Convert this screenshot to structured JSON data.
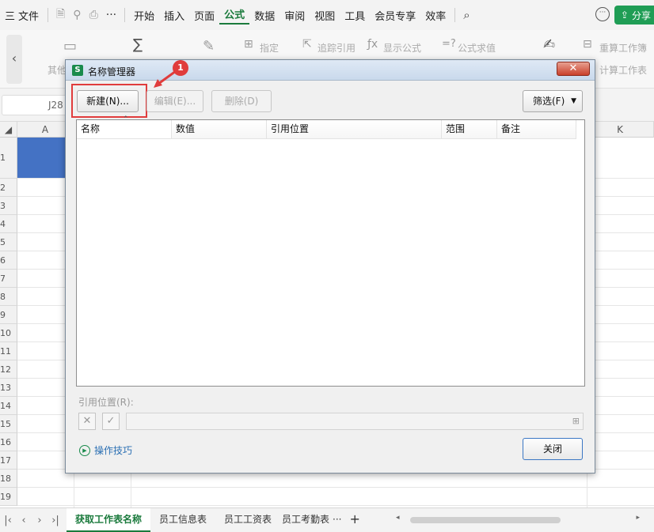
{
  "menubar": {
    "hamburger": "三",
    "file": "文件",
    "tabs": [
      "开始",
      "插入",
      "页面",
      "公式",
      "数据",
      "审阅",
      "视图",
      "工具",
      "会员专享",
      "效率"
    ],
    "active_tab": "公式",
    "share_label": "分享",
    "more": "···"
  },
  "ribbon": {
    "items_row1": [
      "指定",
      "追踪引用",
      "显示公式",
      "公式求值",
      "重算工作簿"
    ],
    "items_row2": [
      "其他",
      "计算工作表"
    ]
  },
  "formulabar": {
    "cell_ref": "J28"
  },
  "grid": {
    "columns": [
      "A",
      "K"
    ],
    "rows": [
      "1",
      "2",
      "3",
      "4",
      "5",
      "6",
      "7",
      "8",
      "9",
      "10",
      "11",
      "12",
      "13",
      "14",
      "15",
      "16",
      "17",
      "18",
      "19"
    ]
  },
  "dialog": {
    "title": "名称管理器",
    "logo": "S",
    "close_glyph": "✕",
    "new_button": "新建(N)...",
    "edit_button": "编辑(E)...",
    "delete_button": "删除(D)",
    "filter_button": "筛选(F)",
    "columns": [
      "名称",
      "数值",
      "引用位置",
      "范围",
      "备注"
    ],
    "ref_label": "引用位置(R):",
    "tips_label": "操作技巧",
    "close_button": "关闭"
  },
  "annotation": {
    "badge": "1",
    "color": "#e03c3c"
  },
  "sheets": {
    "tabs": [
      "获取工作表名称",
      "员工信息表",
      "员工工资表",
      "员工考勤表"
    ],
    "active": "获取工作表名称",
    "more": "···",
    "add": "+"
  },
  "colors": {
    "accent": "#1a7a3c",
    "selection": "#4472c4"
  }
}
